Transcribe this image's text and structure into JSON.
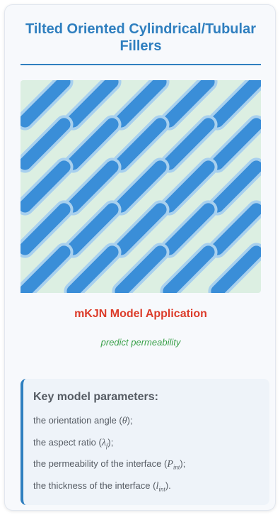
{
  "header": {
    "title": "Tilted Oriented Cylindrical/Tubular Fillers"
  },
  "figure": {
    "background_color": "#dcefe2",
    "interface_color": "#a8d0ee",
    "filler_color": "#3a8ed8",
    "rows": 5,
    "columns": 5,
    "tilt_degrees": 45
  },
  "application": {
    "title": "mKJN Model Application",
    "subtitle": "predict permeability"
  },
  "parameters": {
    "heading": "Key model parameters:",
    "items": [
      {
        "text": "the orientation angle (",
        "symbol": "θ",
        "sub": "",
        "tail": ");"
      },
      {
        "text": "the aspect ratio (",
        "symbol": "λ",
        "sub": "f",
        "tail": ");"
      },
      {
        "text": "the permeability of the interface (",
        "symbol": "P",
        "sub": "int",
        "tail": ");"
      },
      {
        "text": "the thickness of the interface (",
        "symbol": "l",
        "sub": "int",
        "tail": ")."
      }
    ]
  }
}
